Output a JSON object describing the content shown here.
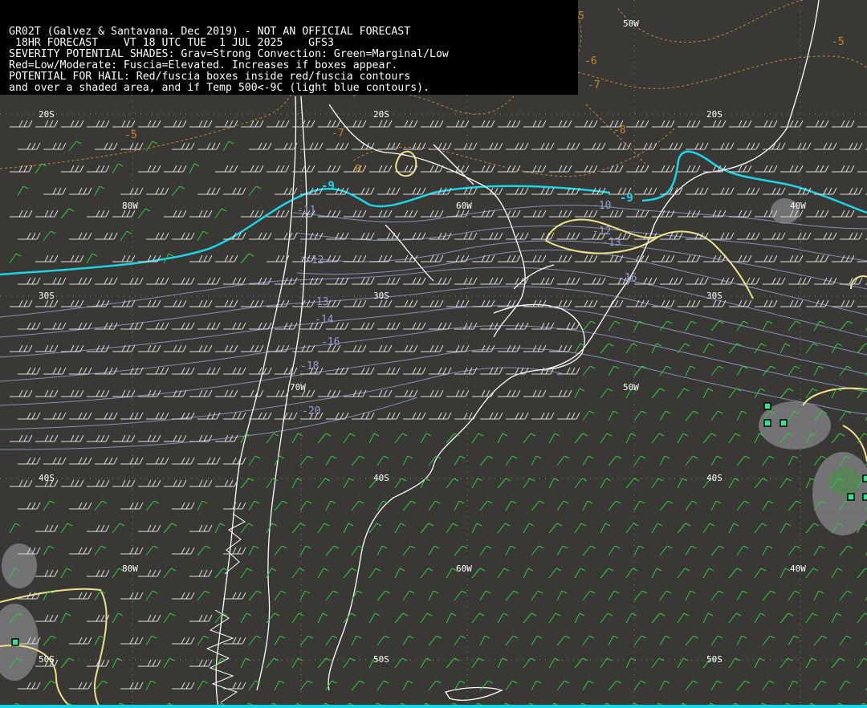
{
  "header": {
    "line1": "GR02T (Galvez & Santavana. Dec 2019) - NOT AN OFFICIAL FORECAST",
    "line2": " 18HR FORECAST    VT 18 UTC TUE  1 JUL 2025    GFS3",
    "line3": "SEVERITY POTENTIAL SHADES: Grav=Strong Convection: Green=Marginal/Low",
    "line4": "Red=Low/Moderate: Fuscia=Elevated. Increases if boxes appear.",
    "line5": "POTENTIAL FOR HAIL: Red/fuscia boxes inside red/fuscia contours",
    "line6": "and over a shaded area, and if Temp 500<-9C (light blue contours)."
  },
  "grid_labels": {
    "lat20_a": "20S",
    "lat20_b": "20S",
    "lat20_c": "20S",
    "lon80_a": "80W",
    "lon60_a": "60W",
    "lon40_a": "40W",
    "lon50_a": "50W",
    "lat30_a": "30S",
    "lat30_b": "30S",
    "lat30_c": "30S",
    "lon70_a": "70W",
    "lon50_b": "50W",
    "lat40_a": "40S",
    "lat40_b": "40S",
    "lat40_c": "40S",
    "lon80_b": "80W",
    "lon60_b": "60W",
    "lon40_b": "40W",
    "lat50_a": "50S",
    "lat50_b": "50S",
    "lat50_c": "50S"
  },
  "temp_labels": {
    "t10": "-10",
    "t11": "-11",
    "t12a": "-12",
    "t12b": "-12",
    "t13a": "-13",
    "t13b": "-13",
    "t14": "-14",
    "t16a": "-16",
    "t16b": "-16",
    "t18": "-18",
    "t20": "-20"
  },
  "orange_labels": {
    "o5a": "-5",
    "o5b": "-5",
    "o5c": "5",
    "o6": "-6",
    "o7a": "-7",
    "o7b": "-7",
    "o8a": "-8",
    "o8b": "8"
  },
  "cyan_labels": {
    "c9a": "-9",
    "c9b": "-9"
  },
  "colors": {
    "background": "#3a3835",
    "coastline": "#ffffff",
    "temp_contour": "#8ea2cc",
    "cyan_contour": "#19d6e8",
    "yellow_contour": "#f0e08a",
    "orange_contour": "#c8862e",
    "barb_white": "#dcdcdc",
    "barb_green": "#2ecc3a",
    "severity_gray": "#7d7d80"
  }
}
